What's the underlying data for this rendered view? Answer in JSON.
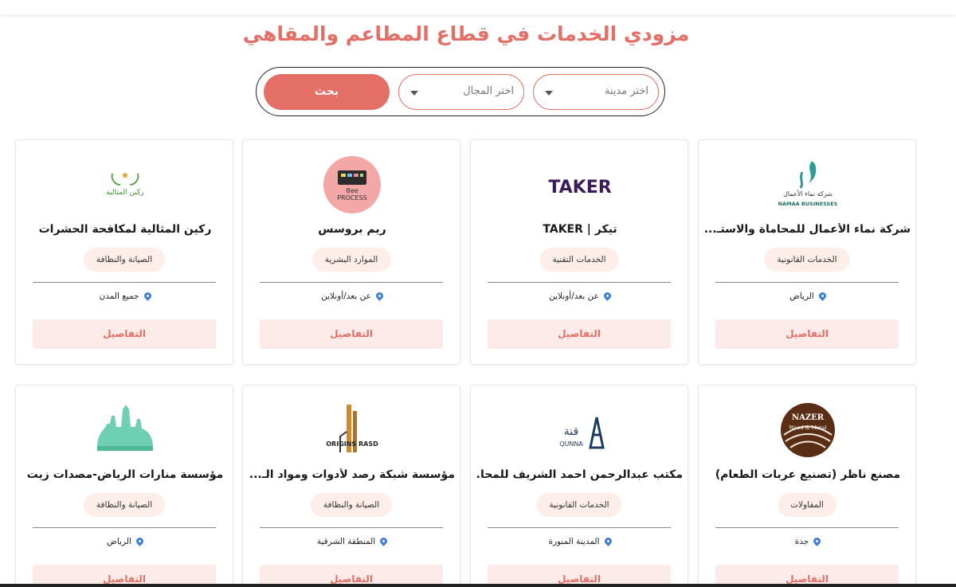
{
  "page": {
    "title": "مزودي الخدمات في قطاع المطاعم والمقاهي"
  },
  "search": {
    "city_placeholder": "اختر مدينة",
    "field_placeholder": "اختر المجال",
    "button_label": "بحث"
  },
  "colors": {
    "accent": "#e36f66",
    "chip_bg": "#fdeeea",
    "pin": "#3d7fd6"
  },
  "cards": [
    {
      "name": "شركة نماء الأعمال للمحاماة والاستـ...",
      "category": "الخدمات القانونية",
      "location": "الرياض",
      "details_label": "التفاصيل",
      "logo_text": "شركة نماء الأعمال",
      "logo_subtext": "NAMAA BUSINESSES"
    },
    {
      "name": "تيكر | TAKER",
      "category": "الخدمات التقنية",
      "location": "عن بعد/أونلاين",
      "details_label": "التفاصيل",
      "logo_text": "TAKER"
    },
    {
      "name": "ريم بروسس",
      "category": "الموارد البشرية",
      "location": "عن بعد/أونلاين",
      "details_label": "التفاصيل",
      "logo_text": "Bee",
      "logo_subtext": "PROCESS"
    },
    {
      "name": "ركين المثالية لمكافحة الحشرات",
      "category": "الصيانة والنظافة",
      "location": "جميع المدن",
      "details_label": "التفاصيل",
      "logo_text": "ركين المثالية"
    },
    {
      "name": "مصنع ناظر (تصنيع عربات الطعام)",
      "category": "المقاولات",
      "location": "جدة",
      "details_label": "التفاصيل",
      "logo_text": "NAZER",
      "logo_subtext": "Wood & Metal"
    },
    {
      "name": "مكتب عبدالرحمن احمد الشريف للمحا...",
      "category": "الخدمات القانونية",
      "location": "المدينة المنورة",
      "details_label": "التفاصيل",
      "logo_text": "قنة",
      "logo_subtext": "QUNNA"
    },
    {
      "name": "مؤسسة شبكة رصد لأدوات ومواد الـ...",
      "category": "الصيانة والنظافة",
      "location": "المنطقة الشرقية",
      "details_label": "التفاصيل",
      "logo_text": "ORIGINS RASD"
    },
    {
      "name": "مؤسسة منارات الرياض-مصدات زيت",
      "category": "الصيانة والنظافة",
      "location": "الرياض",
      "details_label": "التفاصيل"
    }
  ]
}
